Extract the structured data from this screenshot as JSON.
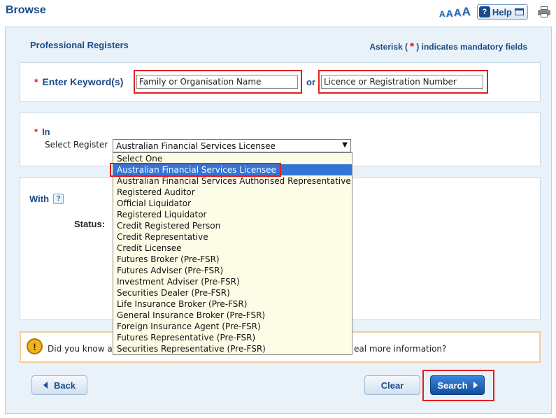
{
  "page": {
    "title": "Browse"
  },
  "toolbar": {
    "font_size_labels": [
      "A",
      "A",
      "A",
      "A"
    ],
    "help_label": "Help",
    "icons": [
      "text-size-icon",
      "help-icon",
      "print-icon"
    ]
  },
  "form": {
    "section_title": "Professional Registers",
    "mandatory_note_prefix": "Asterisk (",
    "mandatory_note_asterisk": "*",
    "mandatory_note_suffix": ") indicates mandatory fields",
    "keyword": {
      "asterisk": "*",
      "label": "Enter Keyword(s)",
      "name_value": "Family or Organisation Name",
      "or_label": "or",
      "number_value": "Licence or Registration Number"
    },
    "in": {
      "asterisk": "*",
      "label": "In",
      "select_label": "Select Register",
      "selected_value": "Australian Financial Services Licensee",
      "dropdown_arrow": "▼",
      "options": [
        "Select One",
        "Australian Financial Services Licensee",
        "Australian Financial Services Authorised Representative",
        "Registered Auditor",
        "Official Liquidator",
        "Registered Liquidator",
        "Credit Registered Person",
        "Credit Representative",
        "Credit Licensee",
        "Futures Broker (Pre-FSR)",
        "Futures Adviser (Pre-FSR)",
        "Investment Adviser (Pre-FSR)",
        "Securities Dealer (Pre-FSR)",
        "Life Insurance Broker (Pre-FSR)",
        "General Insurance Broker (Pre-FSR)",
        "Foreign Insurance Agent (Pre-FSR)",
        "Futures Representative (Pre-FSR)",
        "Securities Representative (Pre-FSR)"
      ],
      "highlighted_index": 1
    },
    "with": {
      "label": "With",
      "help_glyph": "?",
      "status_label": "Status:"
    }
  },
  "info": {
    "icon_glyph": "!",
    "text_left": "Did you know a",
    "text_right": "eal more information?"
  },
  "buttons": {
    "back": "Back",
    "clear": "Clear",
    "search": "Search"
  },
  "colors": {
    "accent": "#1a4c8a",
    "highlight_red": "#e02020",
    "selected_option": "#3375d7",
    "dropdown_bg": "#fdfde7",
    "search_button": "#1f63b8",
    "info_border": "#f2cf9c"
  }
}
